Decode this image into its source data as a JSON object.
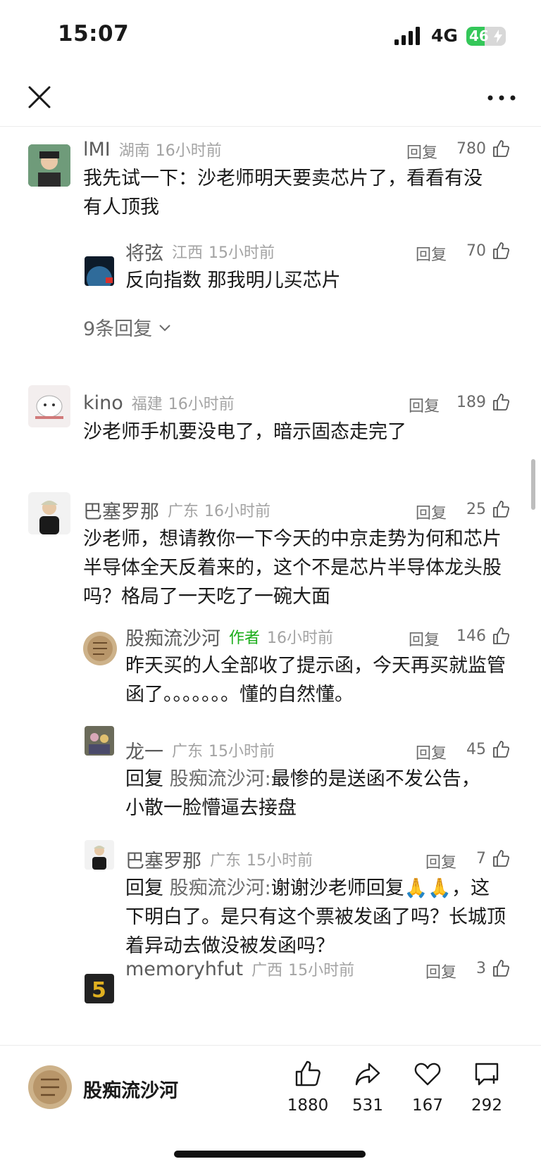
{
  "status_bar": {
    "time": "15:07",
    "network": "4G",
    "battery": "46",
    "battery_level": 0.46
  },
  "navbar": {
    "close_icon": "close-icon",
    "more_icon": "more-icon"
  },
  "comments": [
    {
      "user": "lMI",
      "location": "湖南",
      "time": "16小时前",
      "reply_label": "回复",
      "likes": "780",
      "text": "我先试一下：沙老师明天要卖芯片了，看看有没有人顶我",
      "replies": [
        {
          "user": "将弦",
          "location": "江西",
          "time": "15小时前",
          "reply_label": "回复",
          "likes": "70",
          "text": "反向指数 那我明儿买芯片"
        }
      ],
      "more_replies": "9条回复"
    },
    {
      "user": "kino",
      "location": "福建",
      "time": "16小时前",
      "reply_label": "回复",
      "likes": "189",
      "text": "沙老师手机要没电了，暗示固态走完了"
    },
    {
      "user": "巴塞罗那",
      "location": "广东",
      "time": "16小时前",
      "reply_label": "回复",
      "likes": "25",
      "text": "沙老师，想请教你一下今天的中京走势为何和芯片半导体全天反着来的，这个不是芯片半导体龙头股吗？格局了一天吃了一碗大面",
      "replies": [
        {
          "user": "股痴流沙河",
          "author_tag": "作者",
          "time": "16小时前",
          "reply_label": "回复",
          "likes": "146",
          "text": "昨天买的人全部收了提示函，今天再买就监管函了。。。。。。。懂的自然懂。"
        },
        {
          "user": "龙一",
          "location": "广东",
          "time": "15小时前",
          "reply_label": "回复",
          "likes": "45",
          "reply_prefix": "回复",
          "reply_to": "股痴流沙河:",
          "text": "最惨的是送函不发公告，小散一脸懵逼去接盘"
        },
        {
          "user": "巴塞罗那",
          "location": "广东",
          "time": "15小时前",
          "reply_label": "回复",
          "likes": "7",
          "reply_prefix": "回复",
          "reply_to": "股痴流沙河:",
          "text": "谢谢沙老师回复🙏🙏，这下明白了。是只有这个票被发函了吗？长城顶着异动去做没被发函吗？"
        },
        {
          "user": "memoryhfut",
          "location": "广西",
          "time": "15小时前",
          "reply_label": "回复",
          "likes": "3"
        }
      ]
    }
  ],
  "bottom_bar": {
    "author_name": "股痴流沙河",
    "actions": [
      {
        "icon": "thumb-up-icon",
        "count": "1880"
      },
      {
        "icon": "share-icon",
        "count": "531"
      },
      {
        "icon": "heart-icon",
        "count": "167"
      },
      {
        "icon": "comment-add-icon",
        "count": "292"
      }
    ]
  },
  "colors": {
    "author_tag": "#1aad19",
    "secondary_text": "#a3a3a3",
    "battery_green": "#34c759"
  }
}
